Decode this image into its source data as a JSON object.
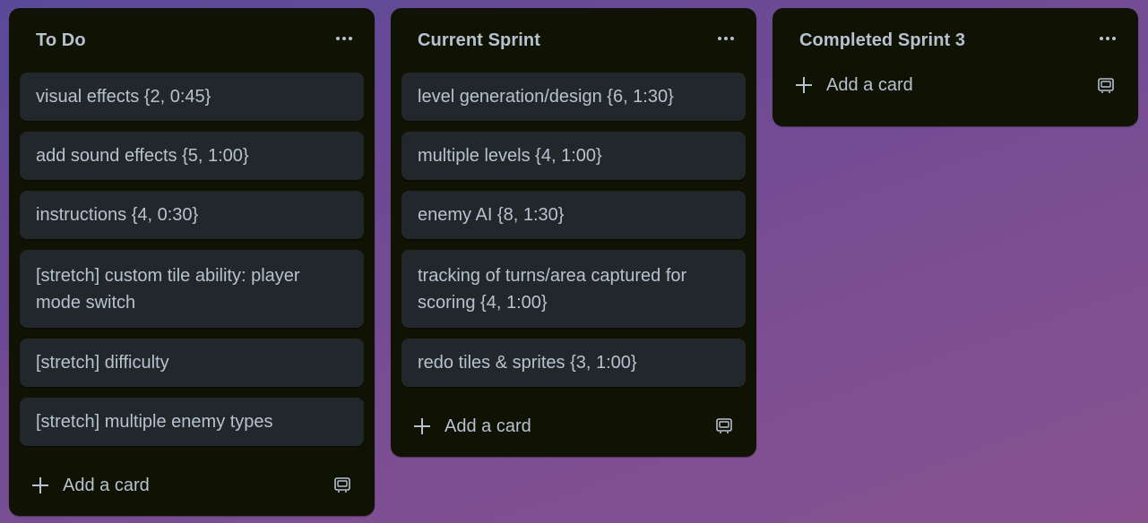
{
  "lists": [
    {
      "title": "To Do",
      "cards": [
        "visual effects {2, 0:45}",
        "add sound effects {5, 1:00}",
        "instructions {4, 0:30}",
        "[stretch] custom tile ability: player mode switch",
        "[stretch] difficulty",
        "[stretch] multiple enemy types"
      ],
      "add_card_label": "Add a card"
    },
    {
      "title": "Current Sprint",
      "cards": [
        "level generation/design {6, 1:30}",
        "multiple levels {4, 1:00}",
        "enemy AI {8, 1:30}",
        "tracking of turns/area captured for scoring {4, 1:00}",
        "redo tiles & sprites {3, 1:00}"
      ],
      "add_card_label": "Add a card"
    },
    {
      "title": "Completed Sprint 3",
      "cards": [],
      "add_card_label": "Add a card"
    }
  ],
  "icons": {
    "list_menu": "more-horizontal-icon",
    "add": "plus-icon",
    "template": "card-template-icon"
  },
  "colors": {
    "list_background": "#101204",
    "card_background": "#22272b",
    "text": "#b6c2cf"
  }
}
